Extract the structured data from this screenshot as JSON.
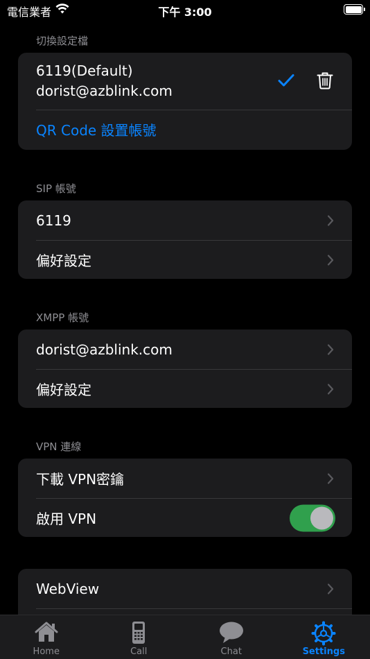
{
  "status": {
    "carrier": "電信業者",
    "time": "下午 3:00"
  },
  "profiles": {
    "header": "切換設定檔",
    "current_name": "6119(Default)",
    "current_account": "dorist@azblink.com",
    "qr_label": "QR Code 設置帳號"
  },
  "sip": {
    "header": "SIP 帳號",
    "account": "6119",
    "prefs": "偏好設定"
  },
  "xmpp": {
    "header": "XMPP 帳號",
    "account": "dorist@azblink.com",
    "prefs": "偏好設定"
  },
  "vpn": {
    "header": "VPN 連線",
    "download": "下載 VPN密鑰",
    "enable": "啟用 VPN",
    "enabled": true
  },
  "misc": {
    "webview": "WebView"
  },
  "tabs": [
    {
      "label": "Home",
      "icon": "home-icon"
    },
    {
      "label": "Call",
      "icon": "phone-icon"
    },
    {
      "label": "Chat",
      "icon": "chat-bubble-icon"
    },
    {
      "label": "Settings",
      "icon": "gear-icon",
      "active": true
    }
  ],
  "colors": {
    "accent": "#0a84ff",
    "toggle_on": "#30a04d",
    "card": "#1c1c1e",
    "background": "#000000"
  }
}
